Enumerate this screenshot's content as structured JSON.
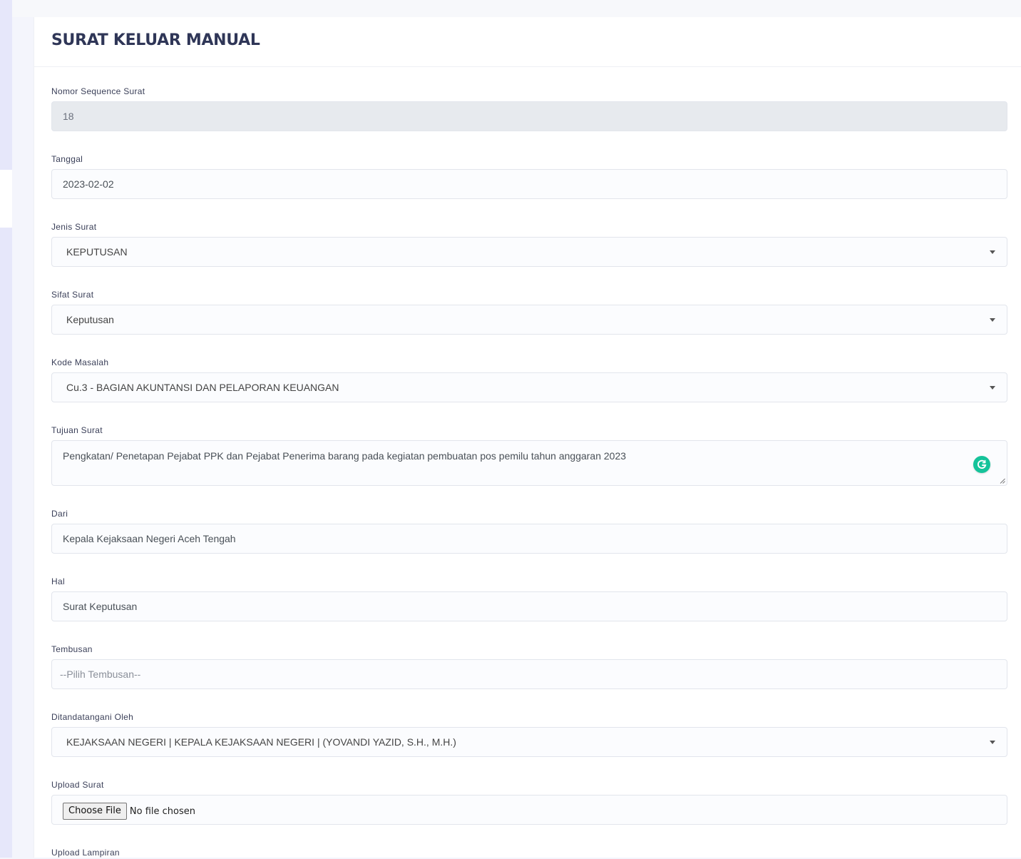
{
  "page": {
    "title": "SURAT KELUAR MANUAL"
  },
  "form": {
    "nomor_sequence": {
      "label": "Nomor Sequence Surat",
      "value": "18"
    },
    "tanggal": {
      "label": "Tanggal",
      "value": "2023-02-02"
    },
    "jenis_surat": {
      "label": "Jenis Surat",
      "value": "KEPUTUSAN"
    },
    "sifat_surat": {
      "label": "Sifat Surat",
      "value": "Keputusan"
    },
    "kode_masalah": {
      "label": "Kode Masalah",
      "value": "Cu.3 - BAGIAN AKUNTANSI DAN PELAPORAN KEUANGAN"
    },
    "tujuan_surat": {
      "label": "Tujuan Surat",
      "value": "Pengkatan/ Penetapan Pejabat PPK dan Pejabat Penerima barang pada kegiatan pembuatan pos pemilu tahun anggaran 2023"
    },
    "dari": {
      "label": "Dari",
      "value": "Kepala Kejaksaan Negeri Aceh Tengah"
    },
    "hal": {
      "label": "Hal",
      "value": "Surat Keputusan"
    },
    "tembusan": {
      "label": "Tembusan",
      "placeholder": "--Pilih Tembusan--"
    },
    "ditandatangani": {
      "label": "Ditandatangani Oleh",
      "value": "KEJAKSAAN NEGERI | KEPALA KEJAKSAAN NEGERI | (YOVANDI YAZID, S.H., M.H.)"
    },
    "upload_surat": {
      "label": "Upload Surat",
      "button_label": "Choose File",
      "status": "No file chosen"
    },
    "upload_lampiran": {
      "label": "Upload Lampiran"
    }
  },
  "icons": {
    "grammarly": "grammarly-icon",
    "dropdown": "chevron-down-icon"
  },
  "colors": {
    "title": "#2f3657",
    "grammarly": "#15c39a",
    "readonly_bg": "#e7eaee",
    "sidebar": "#e6e7fa"
  }
}
